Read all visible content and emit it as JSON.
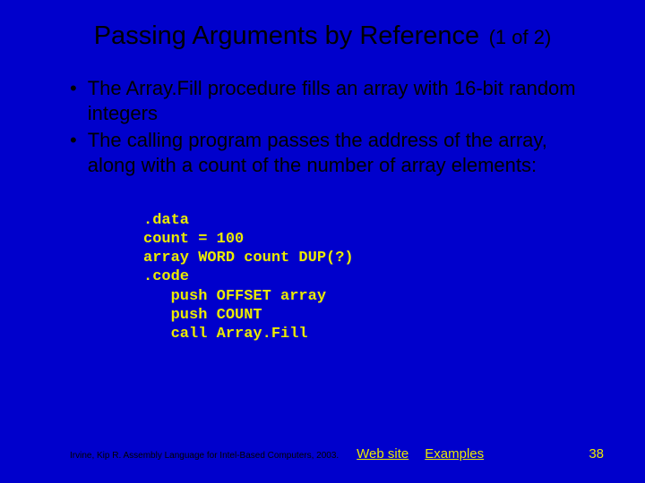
{
  "title": "Passing Arguments by Reference",
  "title_suffix": "(1 of 2)",
  "bullets": [
    "The Array.Fill procedure fills an array with 16-bit random integers",
    "The calling program passes the address of the array, along with a count of the number of array elements:"
  ],
  "code": ".data\ncount = 100\narray WORD count DUP(?)\n.code\n   push OFFSET array\n   push COUNT\n   call Array.Fill",
  "footer": {
    "citation": "Irvine, Kip R. Assembly Language for Intel-Based Computers, 2003.",
    "link_web": "Web site",
    "link_examples": "Examples"
  },
  "page_number": "38"
}
